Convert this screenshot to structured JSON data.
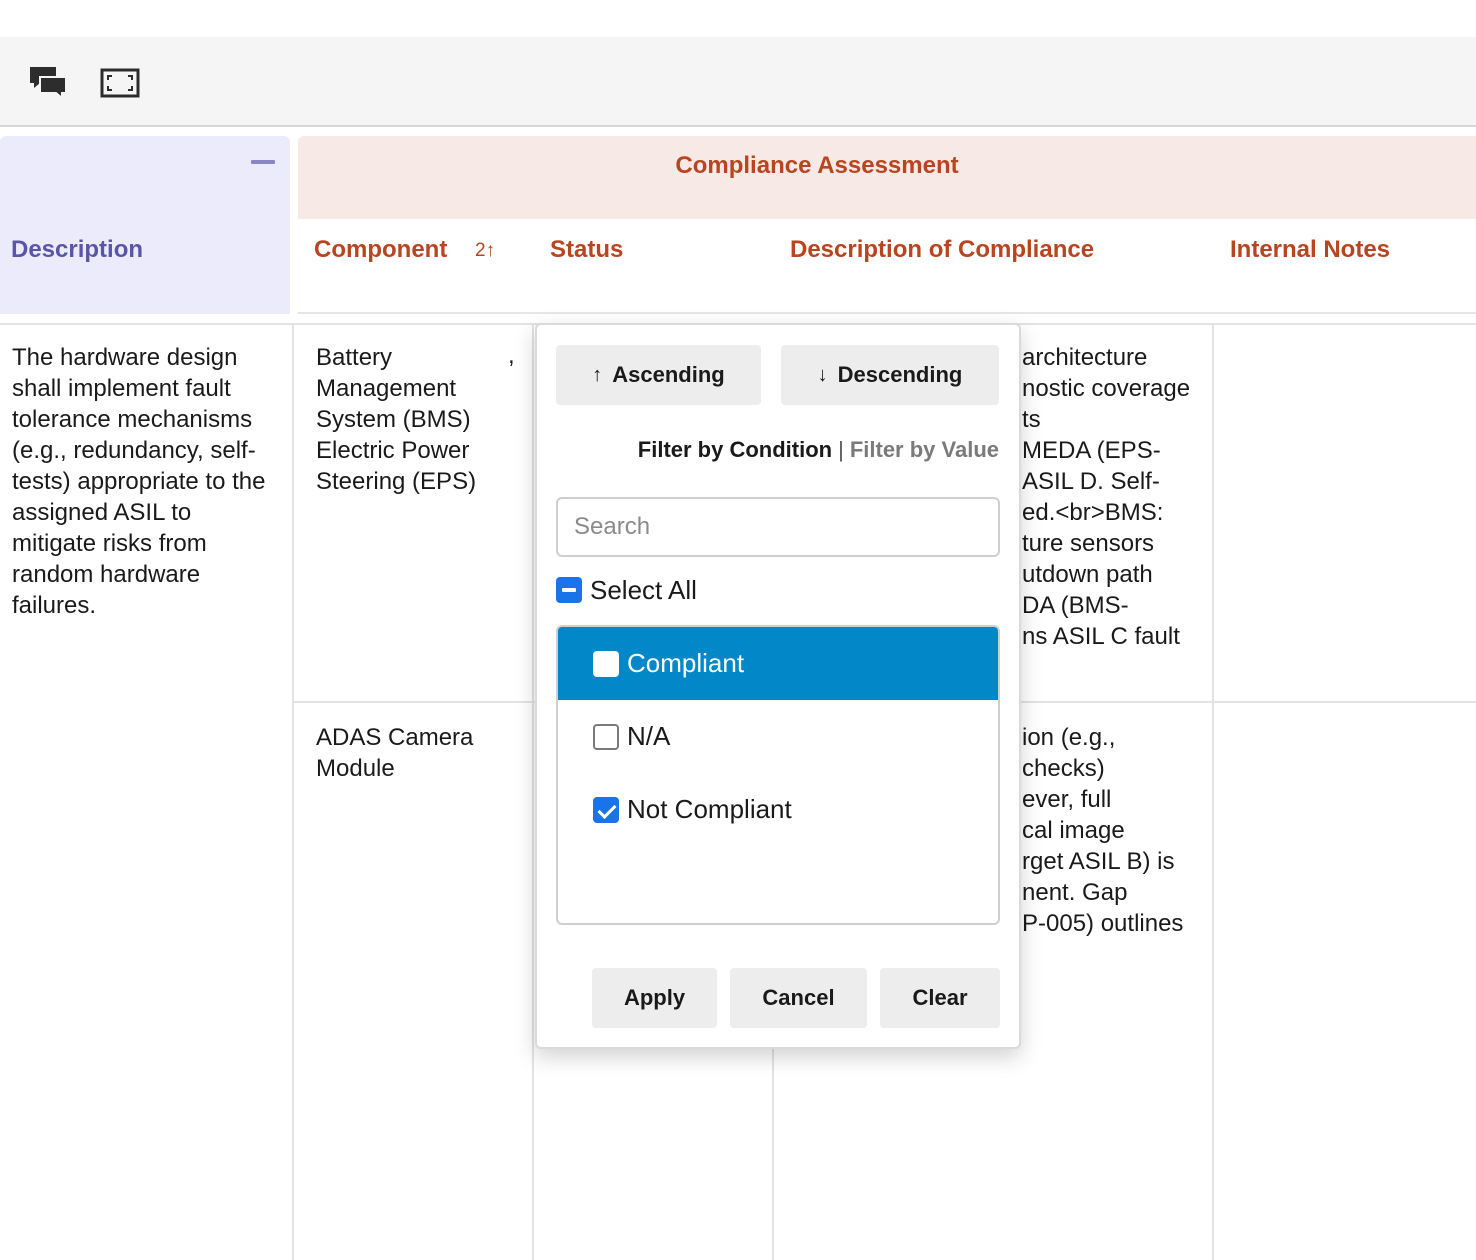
{
  "toolbar": {
    "comments_icon": "comments-icon",
    "expand_icon": "fullscreen-icon"
  },
  "table": {
    "group_headers": {
      "description_group": "",
      "compliance_group": "Compliance Assessment"
    },
    "columns": {
      "description": "Description",
      "component": "Component",
      "component_sort": "2↑",
      "status": "Status",
      "description_of_compliance": "Description of Compliance",
      "internal_notes": "Internal Notes"
    },
    "rows": [
      {
        "description": "The hardware design shall implement fault tolerance mechanisms (e.g., redundancy, self-tests) appropriate to the assigned ASIL to mitigate risks from random hardware failures.",
        "component": "Battery Management System (BMS) Electric Power Steering (EPS)",
        "component_extra": ",",
        "compliance_snippet_lines": [
          "architecture",
          "nostic coverage",
          "ts",
          "MEDA (EPS-",
          "ASIL D. Self-",
          "ed.<br>BMS:",
          "ture sensors",
          "utdown path",
          "DA (BMS-",
          "ns ASIL C fault"
        ]
      },
      {
        "description": "",
        "component": "ADAS Camera Module",
        "component_extra": "",
        "compliance_snippet_lines": [
          "ion (e.g.,",
          "checks)",
          "ever, full",
          "cal image",
          "rget ASIL B) is",
          "nent. Gap",
          "P-005) outlines"
        ]
      }
    ]
  },
  "filter_popup": {
    "sort_asc_label": "Ascending",
    "sort_desc_label": "Descending",
    "sort_asc_arrow": "↑",
    "sort_desc_arrow": "↓",
    "filter_by_condition": "Filter by Condition",
    "separator": "|",
    "filter_by_value": "Filter by Value",
    "search_placeholder": "Search",
    "select_all_label": "Select All",
    "select_all_state": "indeterminate",
    "options": [
      {
        "label": "Compliant",
        "checked": false,
        "highlighted": true
      },
      {
        "label": "N/A",
        "checked": false,
        "highlighted": false
      },
      {
        "label": "Not Compliant",
        "checked": true,
        "highlighted": false
      }
    ],
    "apply_label": "Apply",
    "cancel_label": "Cancel",
    "clear_label": "Clear"
  },
  "colors": {
    "description_group_bg": "#ecebfb",
    "description_header_text": "#5b55a8",
    "compliance_group_bg": "#f7e9e5",
    "compliance_header_text": "#b8451f",
    "highlight_option_bg": "#0287c8",
    "checkbox_blue": "#1a73e8"
  }
}
